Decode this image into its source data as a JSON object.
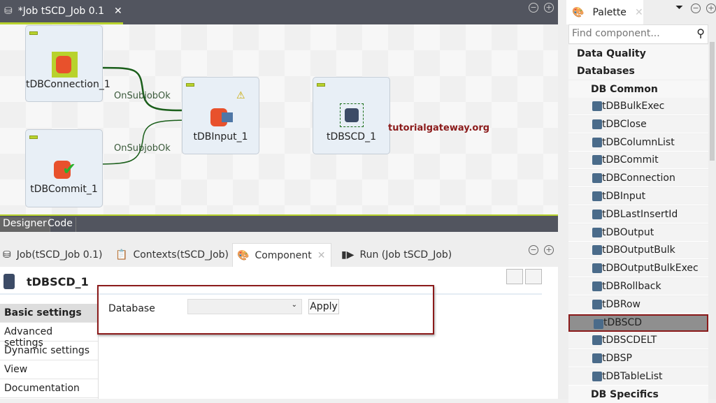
{
  "editor": {
    "tab_title": "*Job tSCD_Job 0.1",
    "designer_tab": "Designer",
    "code_tab": "Code"
  },
  "nodes": [
    {
      "label": "tDBConnection_1"
    },
    {
      "label": "tDBCommit_1"
    },
    {
      "label": "tDBInput_1"
    },
    {
      "label": "tDBSCD_1"
    }
  ],
  "links": [
    "OnSubjobOk",
    "OnSubjobOk"
  ],
  "watermark": "tutorialgateway.org",
  "bottom_tabs": [
    "Job(tSCD_Job 0.1)",
    "Contexts(tSCD_Job)",
    "Component",
    "Run (Job tSCD_Job)"
  ],
  "component": {
    "title": "tDBSCD_1",
    "side_items": [
      "Basic settings",
      "Advanced settings",
      "Dynamic settings",
      "View",
      "Documentation"
    ],
    "database_label": "Database",
    "database_value": "",
    "apply_label": "Apply"
  },
  "palette": {
    "title": "Palette",
    "search_placeholder": "Find component...",
    "categories": [
      "Data Quality",
      "Databases",
      "DB Common"
    ],
    "items": [
      "tDBBulkExec",
      "tDBClose",
      "tDBColumnList",
      "tDBCommit",
      "tDBConnection",
      "tDBInput",
      "tDBLastInsertId",
      "tDBOutput",
      "tDBOutputBulk",
      "tDBOutputBulkExec",
      "tDBRollback",
      "tDBRow",
      "tDBSCD",
      "tDBSCDELT",
      "tDBSP",
      "tDBTableList"
    ],
    "selected": "tDBSCD",
    "next_category": "DB Specifics"
  },
  "colors": {
    "accent": "#b8d22d",
    "dark_bar": "#52555f",
    "selection_border": "#8b1a1a"
  }
}
